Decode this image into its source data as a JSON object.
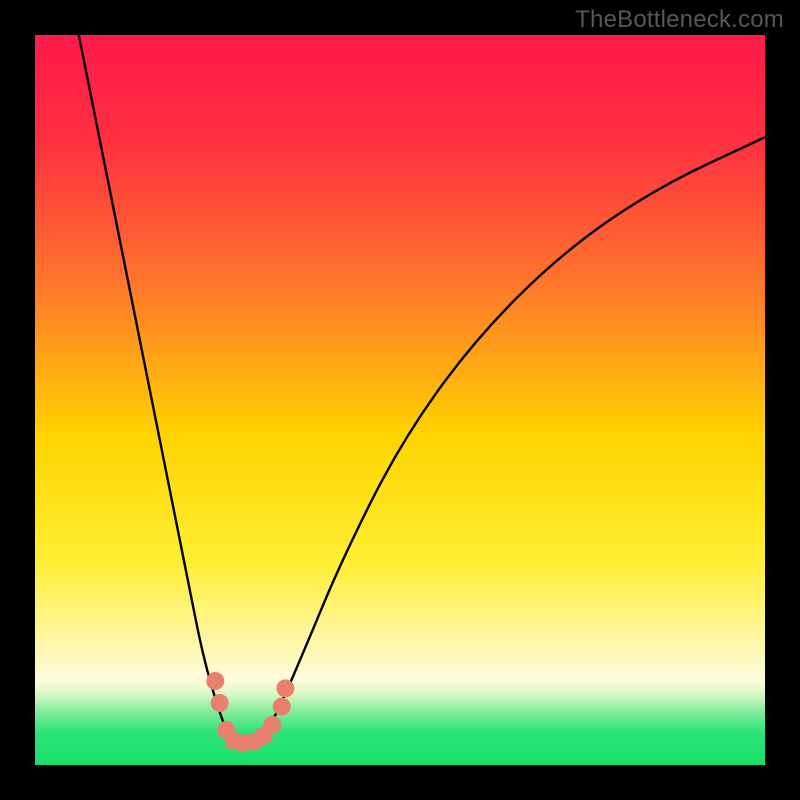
{
  "watermark": "TheBottleneck.com",
  "chart_data": {
    "type": "line",
    "title": "",
    "xlabel": "",
    "ylabel": "",
    "xlim": [
      0,
      100
    ],
    "ylim": [
      0,
      100
    ],
    "background_gradient_stops": [
      {
        "pos": 0.0,
        "color": "#ff1a4a"
      },
      {
        "pos": 0.15,
        "color": "#ff3140"
      },
      {
        "pos": 0.35,
        "color": "#ff7a2a"
      },
      {
        "pos": 0.55,
        "color": "#ffd400"
      },
      {
        "pos": 0.72,
        "color": "#ffee33"
      },
      {
        "pos": 0.84,
        "color": "#fff8b0"
      },
      {
        "pos": 0.885,
        "color": "#fffbe0"
      },
      {
        "pos": 0.905,
        "color": "#d4f6c0"
      },
      {
        "pos": 0.925,
        "color": "#88eda0"
      },
      {
        "pos": 0.955,
        "color": "#2de37a"
      },
      {
        "pos": 1.0,
        "color": "#19e06a"
      }
    ],
    "series": [
      {
        "name": "bottleneck-curve",
        "x": [
          6,
          10,
          14,
          18,
          21,
          23,
          25,
          26.5,
          28,
          30,
          32,
          34,
          37,
          42,
          50,
          60,
          72,
          85,
          100
        ],
        "values": [
          100,
          80,
          60,
          40,
          25,
          15,
          8,
          4,
          3,
          3.5,
          5,
          9,
          16,
          28,
          44,
          58,
          70,
          79,
          86
        ]
      }
    ],
    "markers": {
      "name": "highlighted-points",
      "color": "#e9806e",
      "points": [
        {
          "x": 24.7,
          "y": 11.5
        },
        {
          "x": 25.3,
          "y": 8.5
        },
        {
          "x": 26.2,
          "y": 4.8
        },
        {
          "x": 27.2,
          "y": 3.3
        },
        {
          "x": 28.5,
          "y": 3.0
        },
        {
          "x": 30.0,
          "y": 3.2
        },
        {
          "x": 31.3,
          "y": 4.0
        },
        {
          "x": 32.5,
          "y": 5.5
        },
        {
          "x": 33.8,
          "y": 8.0
        },
        {
          "x": 34.3,
          "y": 10.5
        }
      ]
    }
  }
}
